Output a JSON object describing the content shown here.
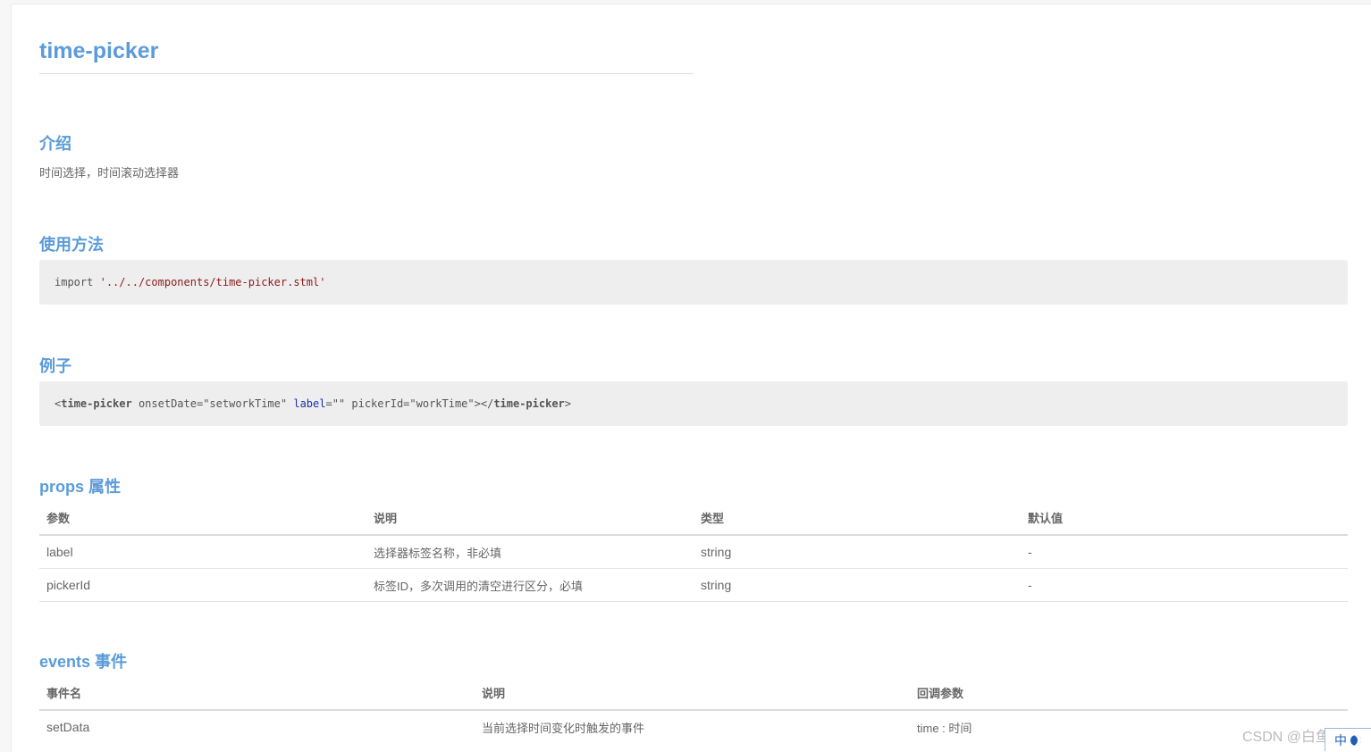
{
  "title": "time-picker",
  "sections": {
    "intro": {
      "heading": "介绍",
      "text": "时间选择，时间滚动选择器"
    },
    "usage": {
      "heading": "使用方法",
      "code_kw": "import",
      "code_str": "'../../components/time-picker.stml'"
    },
    "example": {
      "heading": "例子",
      "code_open": "<",
      "code_tag": "time-picker",
      "code_attr1": " onsetDate=\"setworkTime\" ",
      "code_attr2": "label",
      "code_attr3": "=\"\" pickerId=\"workTime\"></",
      "code_tag2": "time-picker",
      "code_close": ">"
    },
    "props": {
      "heading": "props 属性",
      "headers": [
        "参数",
        "说明",
        "类型",
        "默认值"
      ],
      "rows": [
        [
          "label",
          "选择器标签名称，非必填",
          "string",
          "-"
        ],
        [
          "pickerId",
          "标签ID，多次调用的清空进行区分，必填",
          "string",
          "-"
        ]
      ]
    },
    "events": {
      "heading": "events 事件",
      "headers": [
        "事件名",
        "说明",
        "回调参数"
      ],
      "rows": [
        [
          "setData",
          "当前选择时间变化时触发的事件",
          "time : 时间"
        ]
      ]
    }
  },
  "watermark": "CSDN @白鱼赤乌",
  "ime": {
    "label": "中"
  }
}
